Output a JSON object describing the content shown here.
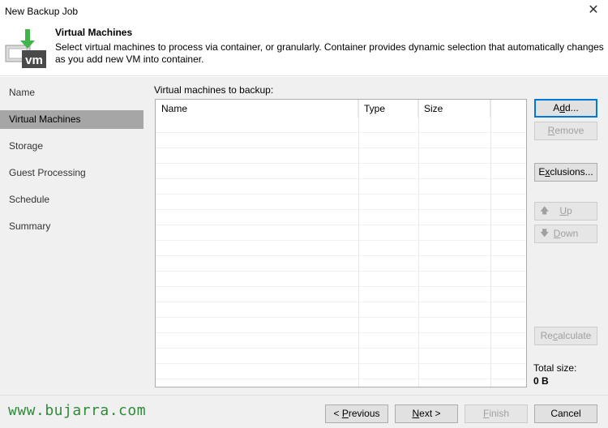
{
  "window": {
    "title": "New Backup Job",
    "close_glyph": "✕"
  },
  "header": {
    "title": "Virtual Machines",
    "description": "Select virtual machines to process via container, or granularly. Container provides dynamic selection that automatically changes as you add new VM into container.",
    "logo_text": "vm",
    "logo_icon": "vm-download-icon"
  },
  "steps": [
    "Name",
    "Virtual Machines",
    "Storage",
    "Guest Processing",
    "Schedule",
    "Summary"
  ],
  "active_step": "Virtual Machines",
  "main": {
    "list_label": "Virtual machines to backup:",
    "columns": [
      "Name",
      "Type",
      "Size"
    ],
    "rows": []
  },
  "buttons": {
    "add": {
      "pre": "A",
      "ul": "d",
      "post": "d..."
    },
    "remove": {
      "pre": "",
      "ul": "R",
      "post": "emove"
    },
    "exclusions": {
      "pre": "E",
      "ul": "x",
      "post": "clusions..."
    },
    "up": {
      "pre": "",
      "ul": "U",
      "post": "p"
    },
    "down": {
      "pre": "",
      "ul": "D",
      "post": "own"
    },
    "recalculate": {
      "pre": "Re",
      "ul": "c",
      "post": "alculate"
    }
  },
  "total": {
    "label": "Total size:",
    "value": "0 B"
  },
  "footer": {
    "watermark": "www.bujarra.com",
    "previous": {
      "pre": "< ",
      "ul": "P",
      "post": "revious"
    },
    "next": {
      "pre": "",
      "ul": "N",
      "post": "ext >"
    },
    "finish": {
      "pre": "",
      "ul": "F",
      "post": "inish"
    },
    "cancel": "Cancel"
  },
  "colors": {
    "watermark": "#2e8b3a",
    "active_step": "#a6a6a6",
    "panel": "#f0f0f0",
    "logo_green": "#3fb54a"
  }
}
